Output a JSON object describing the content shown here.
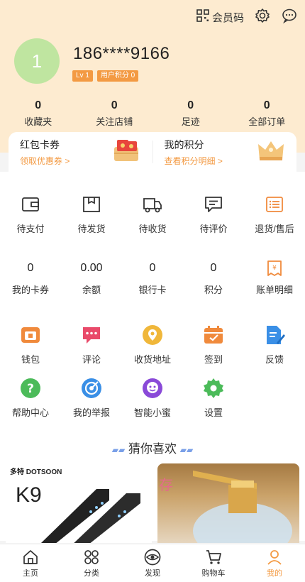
{
  "header": {
    "vip_code_label": "会员码",
    "avatar_text": "1",
    "phone": "186****9166",
    "level_badge": "Lv 1",
    "points_badge": "用户积分 0"
  },
  "stats": [
    {
      "num": "0",
      "label": "收藏夹"
    },
    {
      "num": "0",
      "label": "关注店铺"
    },
    {
      "num": "0",
      "label": "足迹"
    },
    {
      "num": "0",
      "label": "全部订单"
    }
  ],
  "card": {
    "left_title": "红包卡券",
    "left_sub": "领取优惠券 >",
    "right_title": "我的积分",
    "right_sub": "查看积分明细 >"
  },
  "orders": [
    {
      "label": "待支付",
      "icon": "wallet-icon"
    },
    {
      "label": "待发货",
      "icon": "box-icon"
    },
    {
      "label": "待收货",
      "icon": "truck-icon"
    },
    {
      "label": "待评价",
      "icon": "comment-icon"
    },
    {
      "label": "退货/售后",
      "icon": "list-icon"
    }
  ],
  "assets": [
    {
      "value": "0",
      "label": "我的卡券"
    },
    {
      "value": "0.00",
      "label": "余额"
    },
    {
      "value": "0",
      "label": "银行卡"
    },
    {
      "value": "0",
      "label": "积分"
    },
    {
      "value": "",
      "label": "账单明细",
      "icon": "bill-icon"
    }
  ],
  "services": [
    {
      "label": "钱包",
      "icon": "wallet-colored-icon",
      "color": "#f08a3c"
    },
    {
      "label": "评论",
      "icon": "comment-colored-icon",
      "color": "#e94a6a"
    },
    {
      "label": "收货地址",
      "icon": "location-icon",
      "color": "#f0b73a"
    },
    {
      "label": "签到",
      "icon": "calendar-icon",
      "color": "#f08a3c"
    },
    {
      "label": "反馈",
      "icon": "feedback-icon",
      "color": "#3a8fe6"
    },
    {
      "label": "帮助中心",
      "icon": "help-icon",
      "color": "#4cbb5a"
    },
    {
      "label": "我的举报",
      "icon": "report-icon",
      "color": "#3a8fe6"
    },
    {
      "label": "智能小蜜",
      "icon": "robot-icon",
      "color": "#8a4ad8"
    },
    {
      "label": "设置",
      "icon": "gear-icon",
      "color": "#4cbb5a"
    }
  ],
  "guess_title": "猜你喜欢",
  "products": [
    {
      "brand": "多特 DOTSOON",
      "model": "K9"
    },
    {
      "overlay": "存"
    }
  ],
  "tabbar": [
    {
      "label": "主页",
      "icon": "home-icon"
    },
    {
      "label": "分类",
      "icon": "category-icon"
    },
    {
      "label": "发现",
      "icon": "eye-icon"
    },
    {
      "label": "购物车",
      "icon": "cart-icon"
    },
    {
      "label": "我的",
      "icon": "user-icon",
      "active": true
    }
  ],
  "colors": {
    "accent": "#f39a43",
    "header_bg": "#fdebd0"
  }
}
